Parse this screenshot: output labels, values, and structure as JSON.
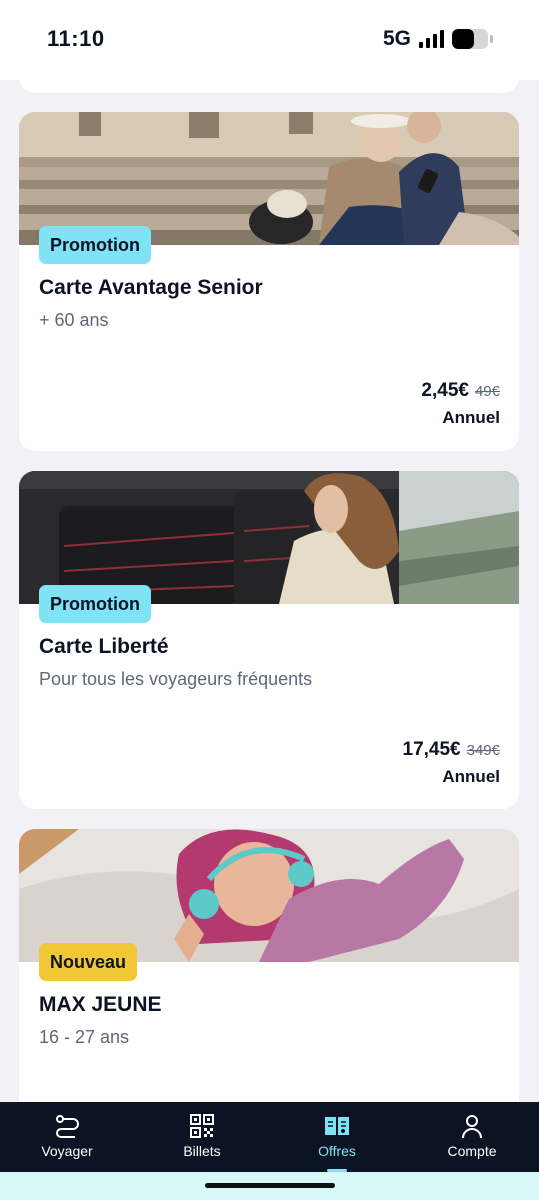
{
  "status": {
    "time": "11:10",
    "network": "5G",
    "battery_level": 0.6
  },
  "offers": [
    {
      "badge": "Promotion",
      "badge_color": "#7fe2f5",
      "title": "Carte Avantage Senior",
      "subtitle": "+ 60 ans",
      "price": "2,45€",
      "old_price": "49€",
      "period": "Annuel"
    },
    {
      "badge": "Promotion",
      "badge_color": "#7fe2f5",
      "title": "Carte Liberté",
      "subtitle": "Pour tous les voyageurs fréquents",
      "price": "17,45€",
      "old_price": "349€",
      "period": "Annuel"
    },
    {
      "badge": "Nouveau",
      "badge_color": "#f2c737",
      "title": "MAX JEUNE",
      "subtitle": "16 - 27 ans"
    }
  ],
  "tabbar": {
    "active": "Offres",
    "items": [
      {
        "label": "Voyager",
        "icon": "route-icon"
      },
      {
        "label": "Billets",
        "icon": "qr-code-icon"
      },
      {
        "label": "Offres",
        "icon": "offers-icon"
      },
      {
        "label": "Compte",
        "icon": "user-icon"
      }
    ]
  },
  "colors": {
    "accent": "#7fe2f5",
    "navy": "#0c1424",
    "new_badge": "#f2c737",
    "background": "#f1f1f6"
  }
}
